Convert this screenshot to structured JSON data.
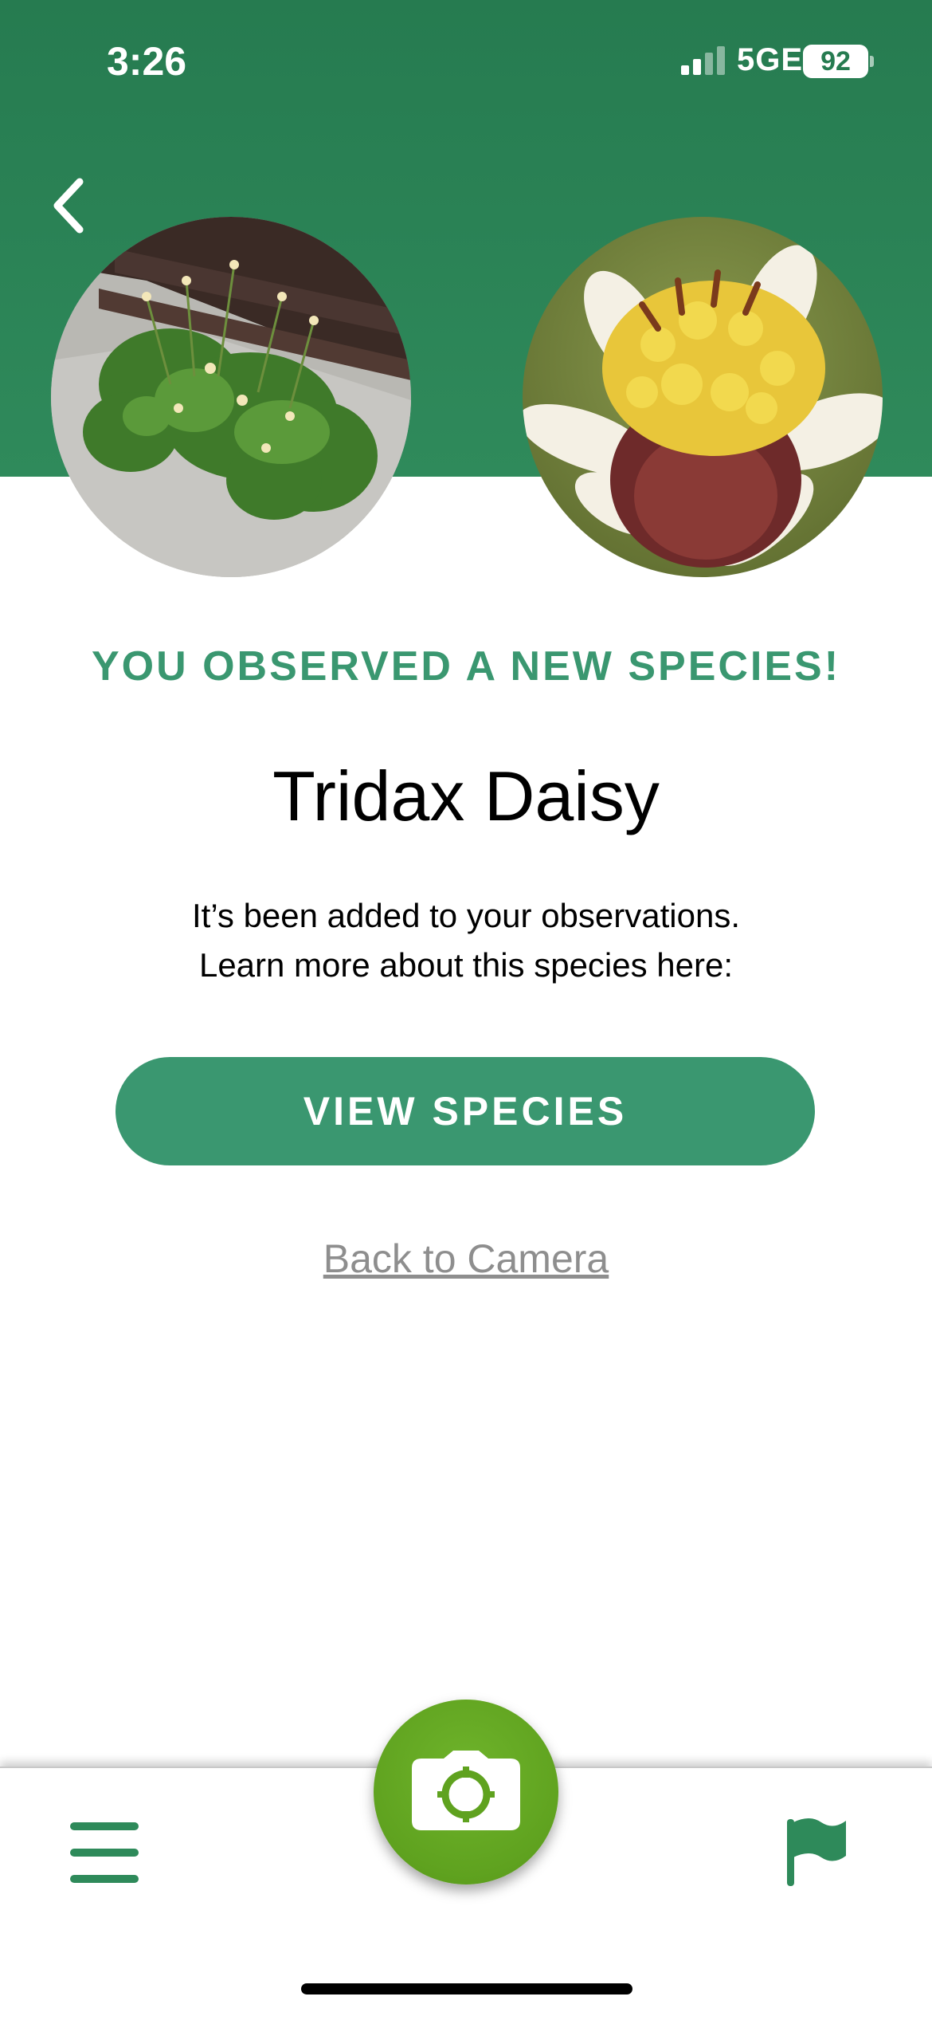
{
  "status_bar": {
    "time": "3:26",
    "network": "5GE",
    "battery": "92"
  },
  "header": {
    "back_icon": "chevron-left-icon",
    "user_photo_label": "observed-plant-photo",
    "species_photo_label": "species-reference-photo"
  },
  "main": {
    "headline": "YOU OBSERVED A NEW SPECIES!",
    "species_name": "Tridax Daisy",
    "body_line1": "It’s been added to your observations.",
    "body_line2": "Learn more about this species here:",
    "view_button_label": "VIEW SPECIES",
    "back_link_label": "Back to Camera"
  },
  "bottom_nav": {
    "menu_icon": "hamburger-menu-icon",
    "camera_icon": "camera-icon",
    "flag_icon": "flag-icon"
  },
  "colors": {
    "header_green": "#267b50",
    "accent_green": "#3a9770",
    "camera_green": "#5fa21f",
    "link_gray": "#8e8e8e"
  }
}
